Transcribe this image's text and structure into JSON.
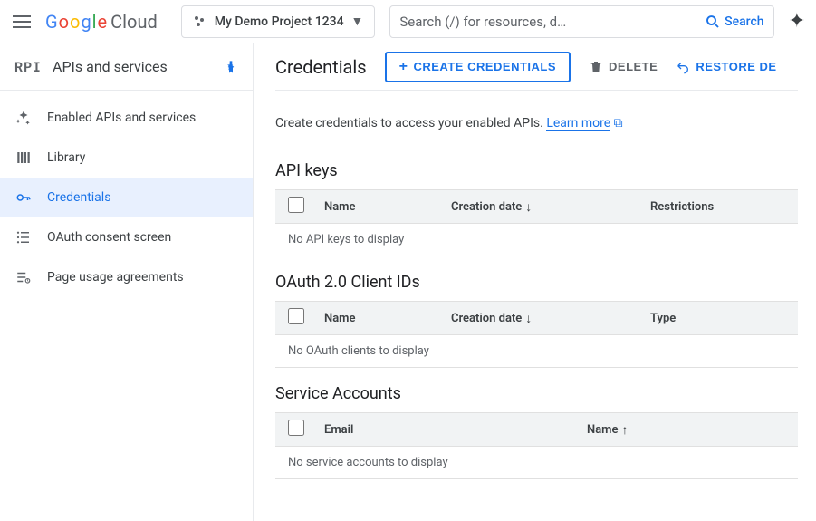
{
  "header": {
    "product": {
      "google": "Google",
      "cloud": "Cloud"
    },
    "project_name": "My Demo Project 1234",
    "search_placeholder": "Search (/) for resources, d…",
    "search_button": "Search"
  },
  "sidebar": {
    "badge": "RPI",
    "title": "APIs and services",
    "items": [
      {
        "label": "Enabled APIs and services"
      },
      {
        "label": "Library"
      },
      {
        "label": "Credentials"
      },
      {
        "label": "OAuth consent screen"
      },
      {
        "label": "Page usage agreements"
      }
    ]
  },
  "main": {
    "title": "Credentials",
    "create_btn": "CREATE CREDENTIALS",
    "delete_btn": "DELETE",
    "restore_btn": "RESTORE DE",
    "intro_text": "Create credentials to access your enabled APIs. ",
    "learn_more": "Learn more",
    "sections": {
      "api_keys": {
        "title": "API keys",
        "cols": {
          "name": "Name",
          "date": "Creation date",
          "restrictions": "Restrictions"
        },
        "empty": "No API keys to display"
      },
      "oauth": {
        "title": "OAuth 2.0 Client IDs",
        "cols": {
          "name": "Name",
          "date": "Creation date",
          "type": "Type"
        },
        "empty": "No OAuth clients to display"
      },
      "sa": {
        "title": "Service Accounts",
        "cols": {
          "email": "Email",
          "name": "Name"
        },
        "empty": "No service accounts to display"
      }
    }
  }
}
